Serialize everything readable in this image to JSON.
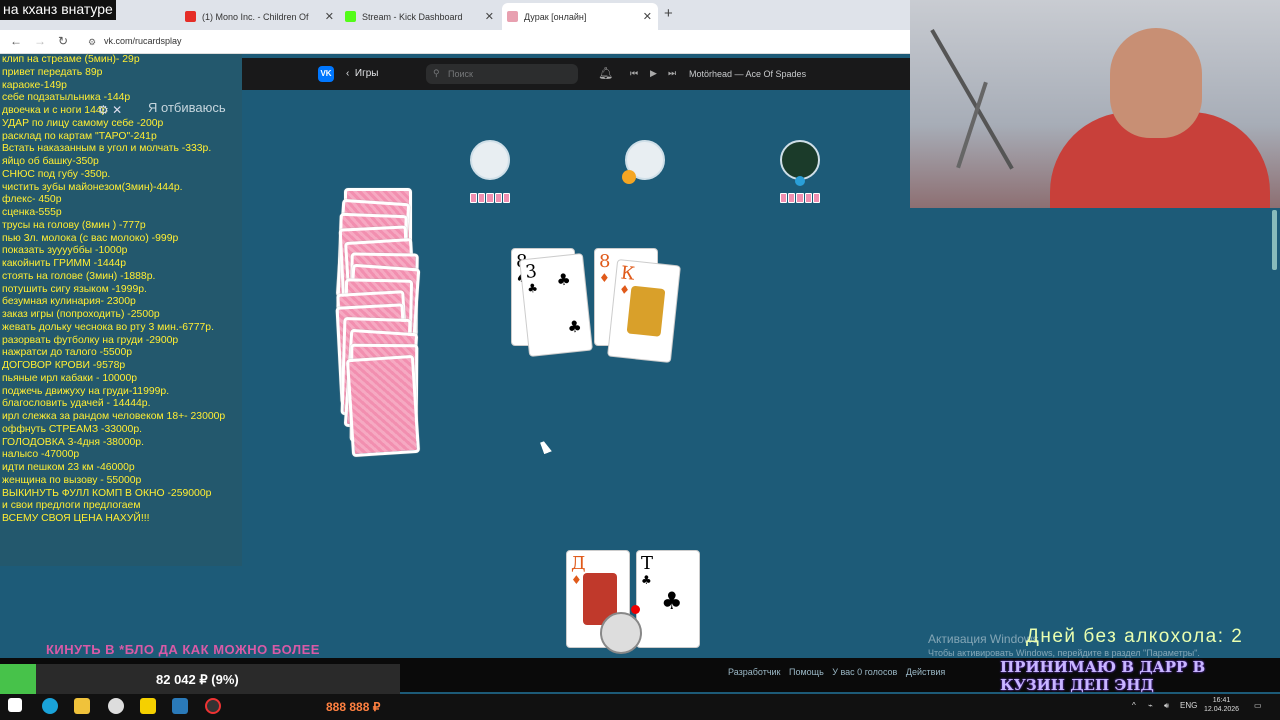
{
  "stream_title": "на кханз внатуре",
  "tabs": [
    {
      "label": "(1) Mono Inc. - Children Of",
      "color": "#e52d27"
    },
    {
      "label": "Stream - Kick Dashboard",
      "color": "#53fc18"
    },
    {
      "label": "Дурак [онлайн]",
      "color": "#e8a0b0"
    }
  ],
  "url": "vk.com/rucardsplay",
  "vk": {
    "games_label": "Игры",
    "search_placeholder": "Поиск",
    "track": "Motörhead — Ace Of Spades"
  },
  "game": {
    "status": "Я отбиваюсь",
    "table_cards": [
      {
        "rank": "8",
        "suit": "♠",
        "color": "#000"
      },
      {
        "rank": "3",
        "suit": "♣",
        "color": "#000"
      },
      {
        "rank": "8",
        "suit": "♦",
        "color": "#e05a1a"
      },
      {
        "rank": "К",
        "suit": "♦",
        "color": "#e05a1a"
      }
    ],
    "hand_cards": [
      {
        "rank": "Д",
        "suit": "♦",
        "color": "#e05a1a"
      },
      {
        "rank": "Т",
        "suit": "♣",
        "color": "#000"
      }
    ],
    "opponent_card_counts": [
      5,
      5,
      5
    ],
    "deck_count": 20
  },
  "price_list": [
    "клип на стреаме (5мин)- 29р",
    "привет передать 89р",
    "караоке-149р",
    "себе подзатыльника -144р",
    "двоечка и с ноги 144р",
    "УДАР по лицу самому себе -200р",
    "расклад по картам \"ТАРО\"-241р",
    "Встать наказанным в угол и молчать -333р.",
    "яйцо об башку-350р",
    "СНЮС под губу -350р.",
    "чистить зубы майонезом(3мин)-444р.",
    "флекс- 450р",
    "сценка-555р",
    "трусы на голову (8мин ) -777р",
    "пью 3л. молока (с вас молоко) -999р",
    "показать зууууббы -1000р",
    "какойнить ГРИММ -1444р",
    "стоять на голове (3мин) -1888р.",
    "потушить сигу языком -1999р.",
    "безумная кулинария- 2300р",
    "заказ игры (попроходить) -2500р",
    "жевать дольку чеснока во рту 3 мин.-6777р.",
    "разорвать футболку на груди -2900р",
    "нажратси до талого -5500р",
    "ДОГОВОР КРОВИ -9578р",
    "пьяные ирл кабаки - 10000р",
    "поджечь движуху на груди-11999р.",
    "благословить удачей - 14444р.",
    "ирл слежка за рандом человеком 18+- 23000р",
    "оффнуть СТРЕАМЗ -33000р.",
    "ГОЛОДОВКА 3-4дня -38000р.",
    "налысо -47000р",
    "идти пешком 23 км -46000р",
    "женщина по вызову - 55000р",
    "ВЫКИНУТЬ ФУЛЛ КОМП В ОКНО -259000р",
    "и свои предлоги предлогаем",
    "ВСЕМУ СВОЯ ЦЕНА НАХУЙ!!!"
  ],
  "marquee": "КИНУТЬ В *БЛО ДА КАК МОЖНО БОЛЕЕ",
  "goal": {
    "text": "82 042 ₽ (9%)",
    "percent": 9
  },
  "footer": {
    "links": [
      "Разработчик",
      "Помощь",
      "У вас 0 голосов",
      "Действия"
    ]
  },
  "activation_title": "Активация Windows",
  "activation_sub": "Чтобы активировать Windows, перейдите в раздел \"Параметры\".",
  "sober_counter": "Дней без алкохола: 2",
  "promo": "ПРИНИМАЮ В ДАРР В КУЗИН ДЕП ЭНД ТОУРНИЕРЗЫ ПОКЕР",
  "taskbar_money": "888 888 ₽",
  "tray_lang": "ENG",
  "clock": {
    "time": "16:41",
    "date": "12.04.2026"
  }
}
